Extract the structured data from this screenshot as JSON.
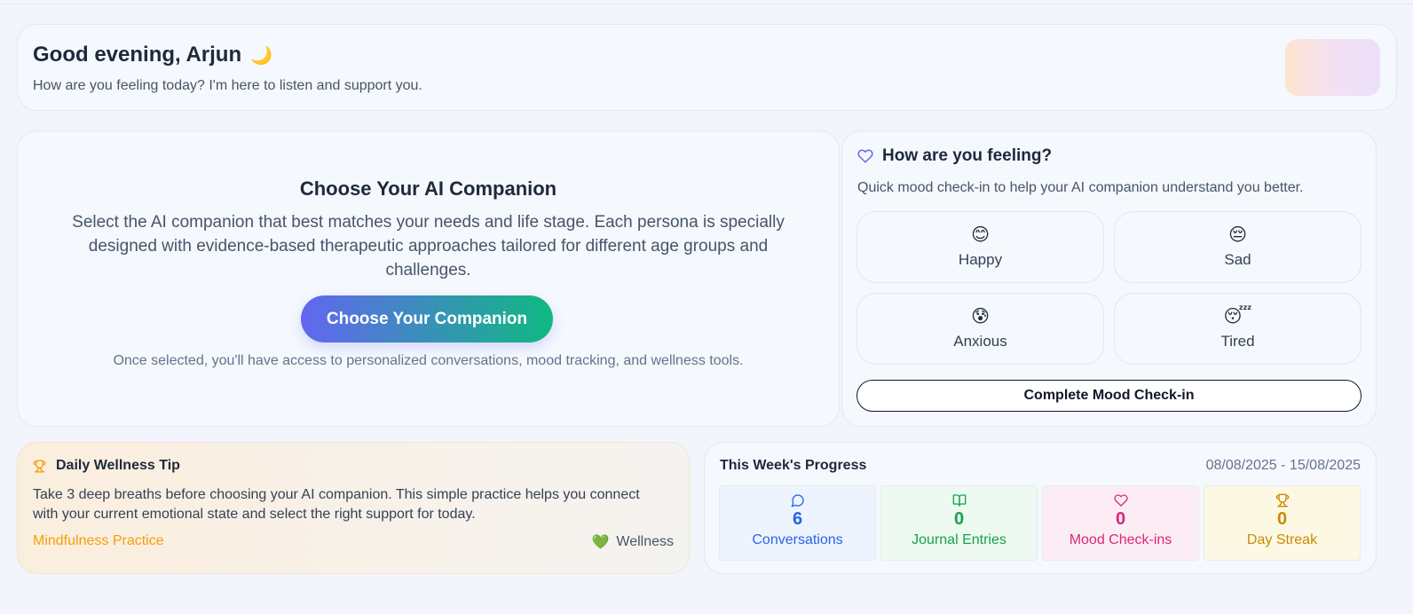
{
  "greeting": {
    "title": "Good evening, Arjun",
    "moon_emoji": "🌙",
    "subtitle": "How are you feeling today? I'm here to listen and support you."
  },
  "companion": {
    "title": "Choose Your AI Companion",
    "description": "Select the AI companion that best matches your needs and life stage. Each persona is specially designed with evidence-based therapeutic approaches tailored for different age groups and challenges.",
    "button_label": "Choose Your Companion",
    "note": "Once selected, you'll have access to personalized conversations, mood tracking, and wellness tools."
  },
  "mood": {
    "title": "How are you feeling?",
    "subtitle": "Quick mood check-in to help your AI companion understand you better.",
    "options": [
      {
        "emoji": "😊",
        "label": "Happy"
      },
      {
        "emoji": "😔",
        "label": "Sad"
      },
      {
        "emoji": "😰",
        "label": "Anxious"
      },
      {
        "emoji": "😴",
        "label": "Tired"
      }
    ],
    "complete_label": "Complete Mood Check-in"
  },
  "tip": {
    "title": "Daily Wellness Tip",
    "body": "Take 3 deep breaths before choosing your AI companion. This simple practice helps you connect with your current emotional state and select the right support for today.",
    "category": "Mindfulness Practice",
    "badge_emoji": "💚",
    "badge_label": "Wellness"
  },
  "progress": {
    "title": "This Week's Progress",
    "date_range": "08/08/2025 - 15/08/2025",
    "stats": [
      {
        "icon": "chat-icon",
        "value": "6",
        "label": "Conversations",
        "color": "#2563eb"
      },
      {
        "icon": "book-icon",
        "value": "0",
        "label": "Journal Entries",
        "color": "#16a34a"
      },
      {
        "icon": "heart-icon",
        "value": "0",
        "label": "Mood Check-ins",
        "color": "#db2777"
      },
      {
        "icon": "trophy-icon",
        "value": "0",
        "label": "Day Streak",
        "color": "#ca8a04"
      }
    ]
  },
  "colors": {
    "accent_indigo": "#6366f1",
    "accent_green": "#10b981",
    "tip_orange": "#f59e0b"
  }
}
